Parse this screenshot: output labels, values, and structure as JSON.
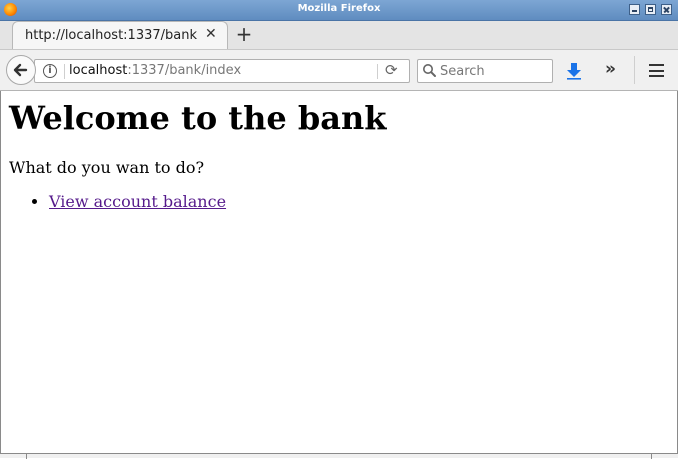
{
  "window": {
    "title": "Mozilla Firefox"
  },
  "tab": {
    "label": "http://localhost:1337/bank/index",
    "close_glyph": "✕",
    "new_tab_glyph": "+"
  },
  "url": {
    "host": "localhost",
    "path": ":1337/bank/index"
  },
  "search": {
    "placeholder": "Search"
  },
  "icons": {
    "back": "back-arrow-icon",
    "info": "info-icon",
    "reload": "reload-icon",
    "search": "magnifier-icon",
    "downloads": "download-arrow-icon",
    "overflow": "double-chevron-icon",
    "menu": "hamburger-icon"
  },
  "colors": {
    "titlebar": "#6d98cb",
    "download_arrow": "#1a73e8",
    "visited_link": "#551a8b"
  },
  "page": {
    "heading": "Welcome to the bank",
    "prompt": "What do you wan to do?",
    "links": [
      {
        "label": "View account balance"
      }
    ]
  }
}
